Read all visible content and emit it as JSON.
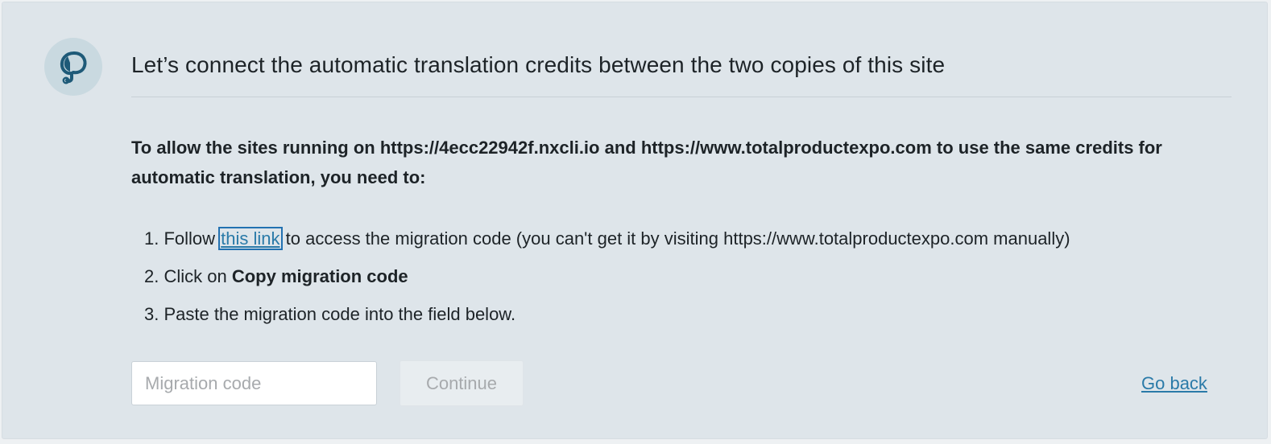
{
  "logo_icon": "wpml-logo-icon",
  "heading": "Let’s connect the automatic translation credits between the two copies of this site",
  "intro": "To allow the sites running on https://4ecc22942f.nxcli.io and https://www.totalproductexpo.com to use the same credits for automatic translation, you need to:",
  "steps": [
    {
      "number": "1.",
      "prefix": "Follow ",
      "link": "this link",
      "suffix": " to access the migration code (you can't get it by visiting https://www.totalproductexpo.com manually)"
    },
    {
      "number": "2.",
      "prefix": "Click on ",
      "bold": "Copy migration code"
    },
    {
      "number": "3.",
      "text": "Paste the migration code into the field below."
    }
  ],
  "migration_input": {
    "placeholder": "Migration code",
    "value": ""
  },
  "continue_label": "Continue",
  "go_back_label": "Go back",
  "colors": {
    "accent": "#2a7aa8",
    "panel": "#dee5ea",
    "logo_bg": "#c9d9e0"
  }
}
